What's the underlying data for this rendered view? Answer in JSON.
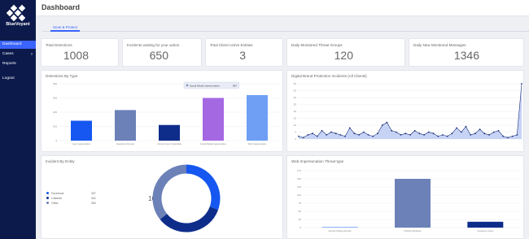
{
  "sidebar": {
    "brand": "BlueVoyant",
    "items": [
      {
        "label": "Dashboard",
        "active": true
      },
      {
        "label": "Cases",
        "active": false
      },
      {
        "label": "Reports",
        "active": false
      },
      {
        "label": "Logout",
        "active": false
      }
    ]
  },
  "header": {
    "title": "Dashboard"
  },
  "tabs": [
    {
      "label": "Scan & Protect"
    }
  ],
  "stats": [
    {
      "title": "Total Detections",
      "value": "1008"
    },
    {
      "title": "Incidents waiting for your action",
      "value": "650"
    },
    {
      "title": "Total Client Active Entities",
      "value": "3"
    },
    {
      "title": "Daily Monitored Threat Groups",
      "value": "120"
    },
    {
      "title": "Daily New Monitored Messages",
      "value": "1346"
    }
  ],
  "detections_chart": {
    "title": "Detections By Type",
    "tooltip": {
      "label": "Social Media Impersonation",
      "value": "307"
    },
    "chart_data": {
      "type": "bar",
      "categories": [
        "App Impersonation",
        "Suspicious Domain",
        "Compromised Credentials",
        "Social Media Impersonation",
        "Web Impersonation"
      ],
      "values": [
        140,
        215,
        110,
        300,
        320
      ],
      "colors": [
        "#1557f0",
        "#6b81b8",
        "#0e2d8a",
        "#a468e3",
        "#6e9ff5"
      ],
      "ylim": [
        0,
        400
      ],
      "yticks": [
        "400",
        "300",
        "200",
        "100",
        "0"
      ]
    }
  },
  "incidents_line": {
    "title": "Digital Brand Protection Incidents (All Clients)",
    "chart_data": {
      "type": "area",
      "values": [
        2,
        1,
        3,
        4,
        2,
        6,
        3,
        5,
        4,
        3,
        2,
        8,
        4,
        3,
        5,
        3,
        2,
        4,
        10,
        12,
        6,
        5,
        3,
        4,
        3,
        6,
        4,
        3,
        5,
        4,
        2,
        3,
        2,
        4,
        8,
        5,
        9,
        3,
        4,
        7,
        4,
        3,
        5,
        6,
        2,
        1,
        2,
        3,
        40
      ],
      "ylim": [
        0,
        40
      ],
      "yticks": [
        "40",
        "35",
        "30",
        "25",
        "20",
        "15",
        "10",
        "5",
        "0"
      ]
    }
  },
  "donut_chart": {
    "title": "Incident By Entity",
    "center_label": "100",
    "legend": [
      {
        "label": "Facebook",
        "value": "307",
        "color": "#1557f0"
      },
      {
        "label": "LinkedIn",
        "value": "341",
        "color": "#0e2d8a"
      },
      {
        "label": "Other",
        "value": "360",
        "color": "#6b81b8"
      }
    ],
    "chart_data": {
      "type": "pie",
      "categories": [
        "Facebook",
        "LinkedIn",
        "Other"
      ],
      "values": [
        307,
        341,
        360
      ]
    }
  },
  "web_chart": {
    "title": "Web Impersonation Threat type",
    "chart_data": {
      "type": "bar",
      "categories": [
        "Domain Parking Domain",
        "Phishing Websites",
        "Suspicious Intent"
      ],
      "values": [
        2,
        150,
        18
      ],
      "colors": [
        "#6e9ff5",
        "#6b81b8",
        "#0e2d8a"
      ],
      "ylim": [
        0,
        175
      ],
      "yticks": [
        "175",
        "150",
        "125",
        "100",
        "75",
        "50",
        "25",
        "0"
      ]
    }
  }
}
